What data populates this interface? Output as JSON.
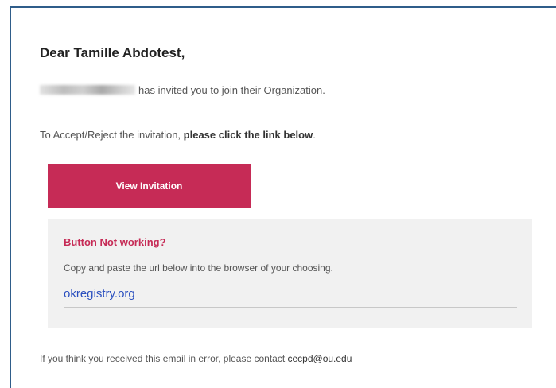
{
  "email": {
    "greeting": "Dear Tamille Abdotest,",
    "invite_text": "has invited you to join their Organization.",
    "instruction_prefix": "To Accept/Reject the invitation, ",
    "instruction_emphasis": "please click the link below",
    "instruction_suffix": ".",
    "view_button_label": "View Invitation",
    "help": {
      "title": "Button Not working?",
      "text": "Copy and paste the url below into the browser of your choosing.",
      "link_text": "okregistry.org"
    },
    "footer_prefix": "If you think you received this email in error, please contact ",
    "contact_email": "cecpd@ou.edu"
  },
  "colors": {
    "accent": "#c62b56",
    "link": "#2a4fbf",
    "help_background": "#f1f1f1",
    "frame_border": "#2f5d8a"
  }
}
